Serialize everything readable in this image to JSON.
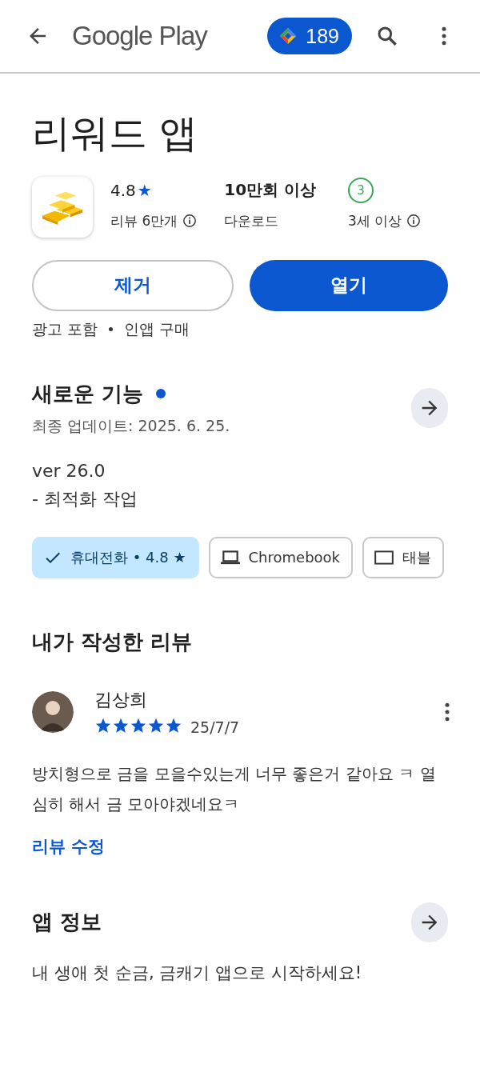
{
  "header": {
    "logo_text": "Google Play",
    "points": "189"
  },
  "app": {
    "title": "리워드 앱",
    "rating": "4.8",
    "rating_star": "★",
    "reviews": "리뷰 6만개",
    "downloads": "10만회 이상",
    "downloads_label": "다운로드",
    "age_badge": "3",
    "age": "3세 이상"
  },
  "buttons": [
    {
      "label": "제거",
      "kind": "outline"
    },
    {
      "label": "열기",
      "kind": "filled"
    }
  ],
  "tags": [
    "광고 포함",
    "인앱 구매"
  ],
  "whats_new": {
    "title": "새로운 기능",
    "has_new": true,
    "updated": "최종 업데이트: 2025. 6. 25.",
    "notes": [
      "ver 26.0",
      "- 최적화 작업"
    ]
  },
  "devices": [
    {
      "label": "휴대전화 • 4.8 ★",
      "selected": true
    },
    {
      "label": "Chromebook",
      "kind": "laptop",
      "selected": false
    },
    {
      "label": "태블",
      "kind": "tablet",
      "selected": false
    }
  ],
  "my_review": {
    "title": "내가 작성한 리뷰",
    "author": "김상희",
    "stars": 5,
    "date": "25/7/7",
    "text": "방치형으로 금을 모을수있는게 너무 좋은거 같아요 ㅋ 열심히 해서 금 모아야겠네요ㅋ",
    "edit_link": "리뷰 수정"
  },
  "app_info": {
    "title": "앱 정보",
    "description": "내 생애 첫 순금, 금캐기 앱으로 시작하세요!"
  }
}
